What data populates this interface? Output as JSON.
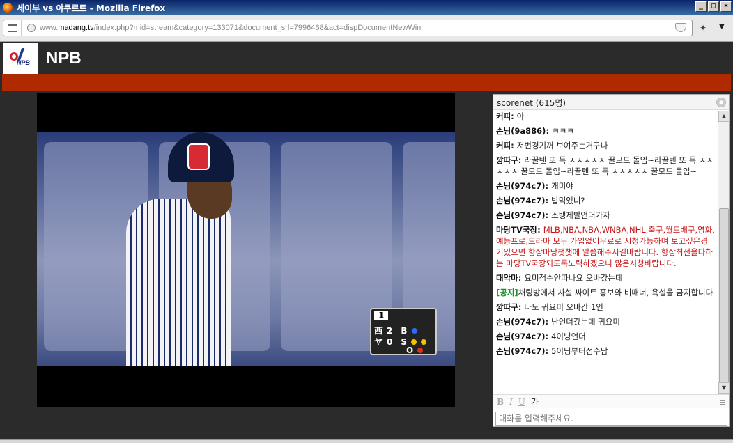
{
  "window": {
    "title": "세이부 vs 야쿠르트 - Mozilla Firefox"
  },
  "browser": {
    "url_prefix": "www.",
    "url_domain": "madang.tv",
    "url_path": "/index.php?mid=stream&category=133071&document_srl=7996468&act=dispDocumentNewWin"
  },
  "header": {
    "title": "NPB",
    "logo_text": "NPB"
  },
  "colors": {
    "header_bg": "#2b2b2b",
    "red_bar": "#b02a00",
    "notice_green": "#179225",
    "highlight_red": "#c41212"
  },
  "video": {
    "scorebug": {
      "inning": "1",
      "team1": "西",
      "team1_score": "2",
      "team2": "ヤ",
      "team2_score": "0",
      "b": "B",
      "s": "S",
      "o": "O"
    }
  },
  "chat": {
    "header": "scorenet (615명)",
    "messages": [
      {
        "nick": "커피",
        "text": "아",
        "style": "normal"
      },
      {
        "nick": "손님(9a886)",
        "text": "ㅋㅋㅋ",
        "style": "normal"
      },
      {
        "nick": "커피",
        "text": "저번경기꺼 보여주는거구나",
        "style": "normal"
      },
      {
        "nick": "깡따구",
        "text": "라꿀텐 또 득 ㅅㅅㅅㅅㅅ 꿀모드 돌입~라꿀텐 또 득 ㅅㅅㅅㅅㅅ 꿀모드 돌입~라꿀텐 또 득 ㅅㅅㅅㅅㅅ 꿀모드 돌입~",
        "style": "normal"
      },
      {
        "nick": "손님(974c7)",
        "text": "개미야",
        "style": "normal"
      },
      {
        "nick": "손님(974c7)",
        "text": "밥먹었니?",
        "style": "normal"
      },
      {
        "nick": "손님(974c7)",
        "text": "소뱅제발언더가자",
        "style": "normal"
      },
      {
        "nick": "마당TV국장",
        "text": "MLB,NBA,NBA,WNBA,NHL,축구,월드배구,영화,예능프로,드라마 모두 가입없이무료로 시청가능하며 보고싶은경기있으면 항상마당챗챗에 말씀해주시길바랍니다. 항상최선을다하는 마당TV국장되도록노력하겠으니 많은시청바랍니다.",
        "style": "red"
      },
      {
        "nick": "대악마",
        "text": "요미점수안따나요 오바갔는데",
        "style": "normal"
      },
      {
        "nick": "[공지]",
        "text": "채팅방에서 사설 싸이트 홍보와 비매너, 욕설을 금지합니다",
        "style": "notice"
      },
      {
        "nick": "깡따구",
        "text": "나도 귀요미 오바간 1인",
        "style": "normal"
      },
      {
        "nick": "손님(974c7)",
        "text": "난언더갔는데 귀요미",
        "style": "normal"
      },
      {
        "nick": "손님(974c7)",
        "text": "4이닝언더",
        "style": "normal"
      },
      {
        "nick": "손님(974c7)",
        "text": "5이닝부터점수남",
        "style": "normal"
      }
    ],
    "format": {
      "bold": "B",
      "italic": "I",
      "underline": "U",
      "font": "가"
    },
    "input_placeholder": "대화를 입력해주세요."
  }
}
